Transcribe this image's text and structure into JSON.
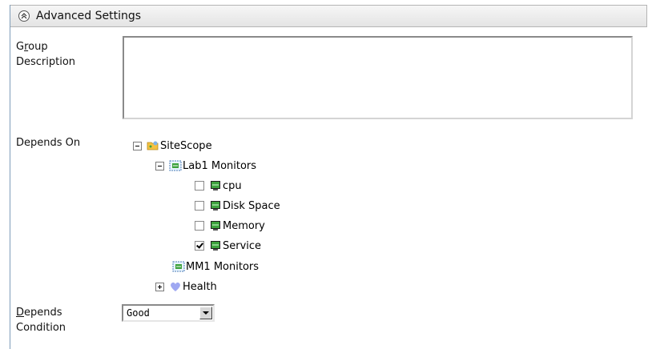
{
  "header": {
    "title": "Advanced Settings",
    "icon": "collapse-up-icon"
  },
  "fields": {
    "group_description": {
      "label_line1_pre": "G",
      "label_line1_u": "r",
      "label_line1_post": "oup",
      "label_line2": "Description",
      "value": ""
    },
    "depends_on": {
      "label": "Depends On"
    },
    "depends_condition": {
      "label_line1_u": "D",
      "label_line1_post": "epends",
      "label_line2": "Condition",
      "selected": "Good"
    }
  },
  "tree": {
    "root": {
      "label": "SiteScope",
      "icon": "folder-icon",
      "expanded": true
    },
    "lab1": {
      "label": "Lab1 Monitors",
      "icon": "monitor-group-icon",
      "expanded": true
    },
    "items": [
      {
        "label": "cpu",
        "checked": false,
        "icon": "monitor-icon"
      },
      {
        "label": "Disk Space",
        "checked": false,
        "icon": "monitor-icon"
      },
      {
        "label": "Memory",
        "checked": false,
        "icon": "monitor-icon"
      },
      {
        "label": "Service",
        "checked": true,
        "icon": "monitor-icon"
      }
    ],
    "mm1": {
      "label": "MM1 Monitors",
      "icon": "monitor-group-icon"
    },
    "health": {
      "label": "Health",
      "icon": "heart-icon",
      "expanded": false
    }
  },
  "colors": {
    "header_bg": "#ececec",
    "border": "#7f9db9",
    "heart": "#9fa8f2",
    "monitor_green": "#3da23d",
    "folder": "#f5c242"
  }
}
